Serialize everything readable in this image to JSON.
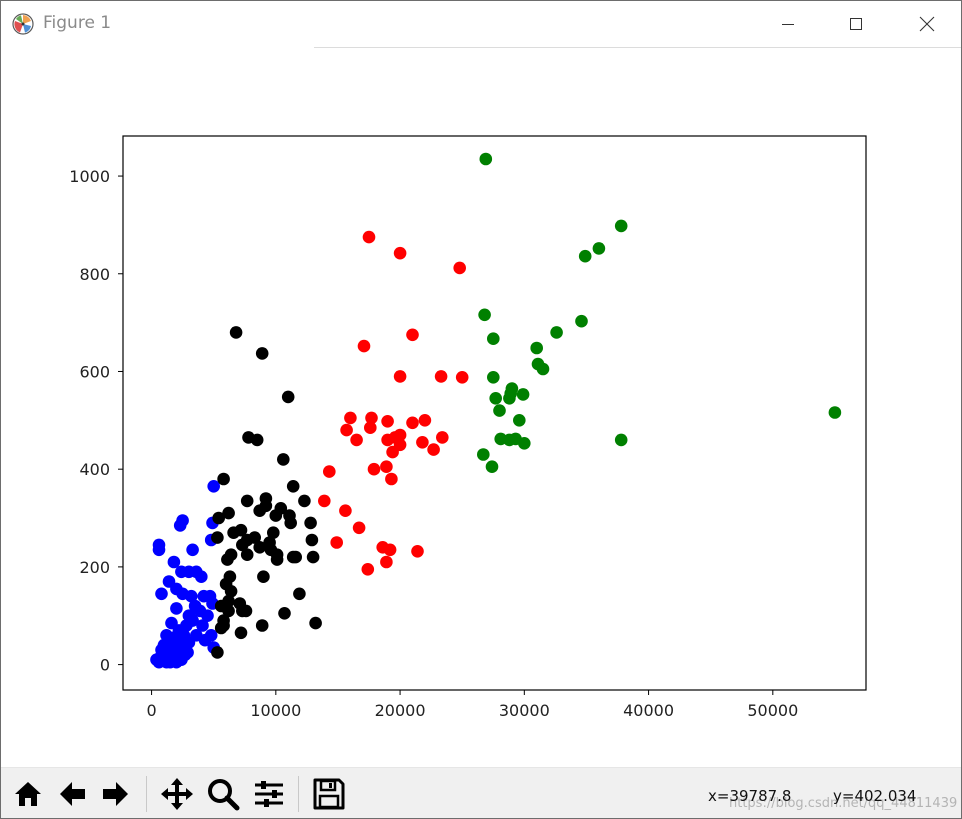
{
  "window": {
    "title": "Figure 1",
    "minimize_icon": "minimize-icon",
    "maximize_icon": "maximize-icon",
    "close_icon": "close-icon"
  },
  "toolbar": {
    "buttons": [
      {
        "name": "home-button",
        "icon": "home-icon"
      },
      {
        "name": "back-button",
        "icon": "arrow-left-icon"
      },
      {
        "name": "forward-button",
        "icon": "arrow-right-icon"
      },
      {
        "name": "pan-button",
        "icon": "move-icon"
      },
      {
        "name": "zoom-button",
        "icon": "search-icon"
      },
      {
        "name": "configure-subplots-button",
        "icon": "sliders-icon"
      },
      {
        "name": "save-button",
        "icon": "save-icon"
      }
    ],
    "x_readout": "x=39787.8",
    "y_readout": "y=402.034",
    "watermark": "https://blog.csdn.net/qq_44811439"
  },
  "chart_data": {
    "type": "scatter",
    "xlim": [
      -2300,
      57500
    ],
    "ylim": [
      -52,
      1082
    ],
    "xticks": [
      0,
      10000,
      20000,
      30000,
      40000,
      50000
    ],
    "yticks": [
      0,
      200,
      400,
      600,
      800,
      1000
    ],
    "xtick_labels": [
      "0",
      "10000",
      "20000",
      "30000",
      "40000",
      "50000"
    ],
    "ytick_labels": [
      "0",
      "200",
      "400",
      "600",
      "800",
      "1000"
    ],
    "grid": false,
    "colors": {
      "blue": "#0000ff",
      "black": "#000000",
      "red": "#ff0000",
      "green": "#008000"
    },
    "series": [
      {
        "color": "#0000ff",
        "points": [
          [
            5000,
            365
          ],
          [
            2500,
            295
          ],
          [
            2300,
            285
          ],
          [
            600,
            245
          ],
          [
            600,
            235
          ],
          [
            4900,
            290
          ],
          [
            4800,
            255
          ],
          [
            3300,
            235
          ],
          [
            1800,
            210
          ],
          [
            2400,
            190
          ],
          [
            3000,
            190
          ],
          [
            3600,
            190
          ],
          [
            4000,
            180
          ],
          [
            1400,
            170
          ],
          [
            2000,
            155
          ],
          [
            800,
            145
          ],
          [
            2500,
            145
          ],
          [
            3200,
            140
          ],
          [
            4200,
            140
          ],
          [
            4700,
            140
          ],
          [
            4900,
            125
          ],
          [
            3500,
            120
          ],
          [
            3900,
            110
          ],
          [
            3000,
            100
          ],
          [
            2000,
            115
          ],
          [
            4500,
            100
          ],
          [
            2800,
            80
          ],
          [
            3300,
            90
          ],
          [
            4100,
            80
          ],
          [
            1600,
            85
          ],
          [
            2200,
            70
          ],
          [
            2600,
            60
          ],
          [
            1200,
            60
          ],
          [
            4800,
            60
          ],
          [
            4300,
            50
          ],
          [
            1800,
            55
          ],
          [
            3600,
            60
          ],
          [
            3000,
            45
          ],
          [
            2200,
            45
          ],
          [
            1000,
            40
          ],
          [
            2500,
            35
          ],
          [
            800,
            30
          ],
          [
            5000,
            35
          ],
          [
            1600,
            30
          ],
          [
            2900,
            25
          ],
          [
            1300,
            20
          ],
          [
            2100,
            20
          ],
          [
            700,
            15
          ],
          [
            1800,
            15
          ],
          [
            400,
            10
          ],
          [
            1000,
            10
          ],
          [
            1500,
            5
          ],
          [
            2400,
            10
          ],
          [
            600,
            5
          ],
          [
            1200,
            5
          ],
          [
            2000,
            5
          ],
          [
            900,
            25
          ],
          [
            1700,
            40
          ],
          [
            2700,
            20
          ]
        ]
      },
      {
        "color": "#000000",
        "points": [
          [
            6800,
            680
          ],
          [
            8900,
            637
          ],
          [
            11000,
            548
          ],
          [
            7800,
            465
          ],
          [
            8500,
            460
          ],
          [
            10600,
            420
          ],
          [
            5800,
            380
          ],
          [
            11400,
            365
          ],
          [
            9200,
            340
          ],
          [
            7700,
            335
          ],
          [
            12300,
            335
          ],
          [
            9200,
            325
          ],
          [
            10400,
            320
          ],
          [
            8700,
            315
          ],
          [
            6200,
            310
          ],
          [
            5400,
            300
          ],
          [
            10000,
            305
          ],
          [
            11100,
            305
          ],
          [
            12800,
            290
          ],
          [
            11200,
            290
          ],
          [
            7200,
            275
          ],
          [
            6600,
            270
          ],
          [
            9800,
            270
          ],
          [
            5300,
            260
          ],
          [
            8300,
            260
          ],
          [
            7700,
            255
          ],
          [
            9500,
            250
          ],
          [
            12900,
            255
          ],
          [
            7300,
            245
          ],
          [
            8700,
            240
          ],
          [
            9600,
            235
          ],
          [
            10100,
            225
          ],
          [
            6400,
            225
          ],
          [
            11600,
            220
          ],
          [
            11400,
            220
          ],
          [
            7700,
            225
          ],
          [
            13000,
            220
          ],
          [
            6100,
            215
          ],
          [
            10100,
            215
          ],
          [
            6300,
            180
          ],
          [
            9000,
            180
          ],
          [
            6000,
            165
          ],
          [
            6400,
            150
          ],
          [
            11900,
            145
          ],
          [
            6200,
            130
          ],
          [
            5600,
            120
          ],
          [
            7100,
            125
          ],
          [
            7300,
            110
          ],
          [
            6200,
            110
          ],
          [
            7600,
            110
          ],
          [
            10700,
            105
          ],
          [
            5800,
            90
          ],
          [
            5800,
            80
          ],
          [
            8900,
            80
          ],
          [
            13200,
            85
          ],
          [
            5600,
            75
          ],
          [
            7200,
            65
          ],
          [
            5300,
            25
          ]
        ]
      },
      {
        "color": "#ff0000",
        "points": [
          [
            17500,
            875
          ],
          [
            20000,
            842
          ],
          [
            24800,
            812
          ],
          [
            21000,
            675
          ],
          [
            17100,
            652
          ],
          [
            20000,
            590
          ],
          [
            23300,
            590
          ],
          [
            25000,
            588
          ],
          [
            16000,
            505
          ],
          [
            17700,
            505
          ],
          [
            19000,
            498
          ],
          [
            21000,
            495
          ],
          [
            22000,
            500
          ],
          [
            15700,
            480
          ],
          [
            17600,
            485
          ],
          [
            20000,
            470
          ],
          [
            23400,
            465
          ],
          [
            16500,
            460
          ],
          [
            19000,
            460
          ],
          [
            19600,
            465
          ],
          [
            20000,
            450
          ],
          [
            21800,
            455
          ],
          [
            22700,
            440
          ],
          [
            19400,
            435
          ],
          [
            14300,
            395
          ],
          [
            17900,
            400
          ],
          [
            18900,
            405
          ],
          [
            19300,
            380
          ],
          [
            13900,
            335
          ],
          [
            15600,
            315
          ],
          [
            16700,
            280
          ],
          [
            14900,
            250
          ],
          [
            18600,
            240
          ],
          [
            19200,
            235
          ],
          [
            21400,
            232
          ],
          [
            17400,
            195
          ],
          [
            18900,
            210
          ]
        ]
      },
      {
        "color": "#008000",
        "points": [
          [
            26900,
            1035
          ],
          [
            37800,
            898
          ],
          [
            36000,
            852
          ],
          [
            34900,
            836
          ],
          [
            26800,
            716
          ],
          [
            34600,
            703
          ],
          [
            32600,
            680
          ],
          [
            27500,
            667
          ],
          [
            31000,
            648
          ],
          [
            31100,
            615
          ],
          [
            31500,
            605
          ],
          [
            27500,
            588
          ],
          [
            29000,
            565
          ],
          [
            28900,
            555
          ],
          [
            29900,
            553
          ],
          [
            27700,
            545
          ],
          [
            28800,
            545
          ],
          [
            28000,
            520
          ],
          [
            29600,
            500
          ],
          [
            55000,
            516
          ],
          [
            28100,
            462
          ],
          [
            28800,
            460
          ],
          [
            29300,
            462
          ],
          [
            37800,
            460
          ],
          [
            30000,
            453
          ],
          [
            26700,
            430
          ],
          [
            27400,
            405
          ]
        ]
      }
    ]
  }
}
